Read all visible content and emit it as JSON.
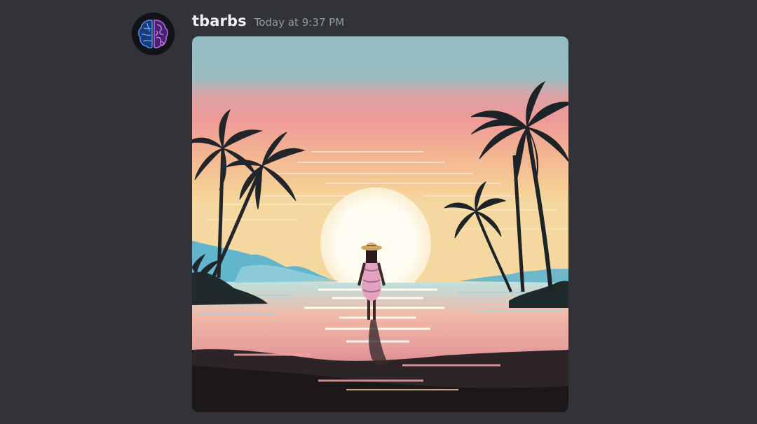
{
  "message": {
    "author": "tbarbs",
    "timestamp": "Today at 9:37 PM",
    "avatar_icon": "brain-icon",
    "attachment": {
      "type": "image",
      "subject": "sunset-beach-palms-woman-walking"
    }
  },
  "colors": {
    "background": "#313338",
    "username": "#f2f3f5",
    "timestamp": "#949ba4",
    "avatar_left_hemisphere": "#3a78d8",
    "avatar_right_hemisphere": "#a25ad8"
  }
}
